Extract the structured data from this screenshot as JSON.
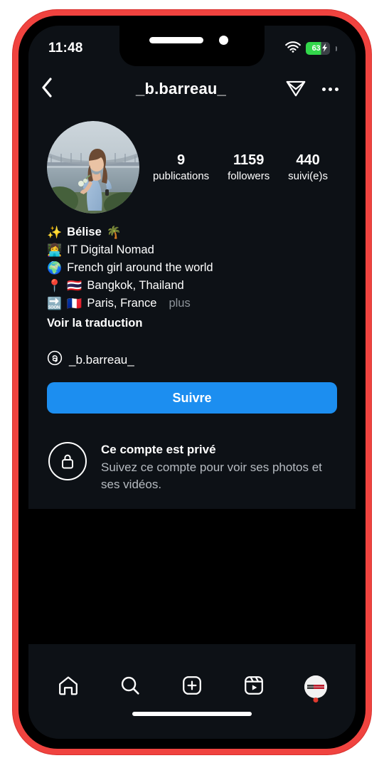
{
  "device": {
    "frame_color": "#f0433f",
    "screen_bg": "#0d1116"
  },
  "status_bar": {
    "time": "11:48",
    "wifi_icon": "wifi-icon",
    "battery_level": "63",
    "battery_charging": true,
    "battery_bolt": "⚡",
    "battery_color": "#32d74b"
  },
  "header": {
    "back_icon": "chevron-left-icon",
    "title": "_b.barreau_",
    "share_icon": "paper-plane-icon",
    "menu_icon": "more-options-icon"
  },
  "profile": {
    "avatar_alt": "profile-photo",
    "stats": [
      {
        "value": "9",
        "label": "publications"
      },
      {
        "value": "1159",
        "label": "followers"
      },
      {
        "value": "440",
        "label": "suivi(e)s"
      }
    ],
    "bio": [
      {
        "emoji": "✨",
        "text": "Bélise",
        "bold": true,
        "trailing_emoji": "🌴"
      },
      {
        "emoji": "👩‍💻",
        "text": "IT Digital Nomad"
      },
      {
        "emoji": "🌍",
        "text": "French girl around the world"
      },
      {
        "emoji": "📍",
        "flag": "🇹🇭",
        "text": "Bangkok, Thailand"
      },
      {
        "emoji": "🔜",
        "flag": "🇫🇷",
        "text": "Paris, France",
        "more": "plus"
      }
    ],
    "translate_label": "Voir la traduction",
    "threads": {
      "icon": "threads-icon",
      "handle": "_b.barreau_"
    },
    "follow_button": {
      "label": "Suivre",
      "color": "#1c8ef0"
    }
  },
  "private_notice": {
    "lock_icon": "lock-icon",
    "title": "Ce compte est privé",
    "subtitle": "Suivez ce compte pour voir ses photos et ses vidéos."
  },
  "bottom_nav": {
    "items": [
      {
        "icon": "home-icon",
        "name": "home"
      },
      {
        "icon": "search-icon",
        "name": "search"
      },
      {
        "icon": "add-post-icon",
        "name": "create"
      },
      {
        "icon": "reels-icon",
        "name": "reels"
      },
      {
        "icon": "profile-avatar-icon",
        "name": "profile",
        "badge": true
      }
    ],
    "badge_color": "#e03a2f"
  }
}
